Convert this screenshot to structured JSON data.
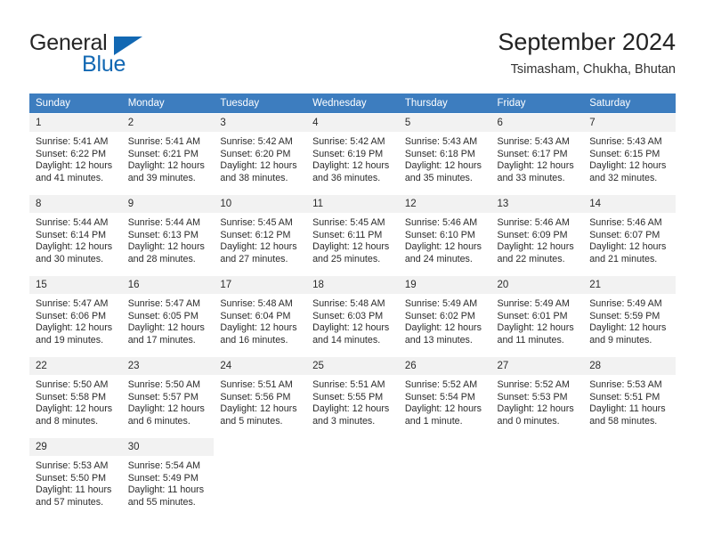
{
  "brand": {
    "name_part1": "General",
    "name_part2": "Blue",
    "triangle_color": "#1268b3",
    "text_color": "#262626"
  },
  "header": {
    "title": "September 2024",
    "subtitle": "Tsimasham, Chukha, Bhutan"
  },
  "colors": {
    "header_row": "#3d7dbf",
    "daynum_bar": "#f2f2f2",
    "separator": "#d9d9d9",
    "accent_blue": "#1268b3"
  },
  "weekdays": [
    "Sunday",
    "Monday",
    "Tuesday",
    "Wednesday",
    "Thursday",
    "Friday",
    "Saturday"
  ],
  "weeks": [
    [
      {
        "day": "1",
        "sunrise": "Sunrise: 5:41 AM",
        "sunset": "Sunset: 6:22 PM",
        "daylight1": "Daylight: 12 hours",
        "daylight2": "and 41 minutes."
      },
      {
        "day": "2",
        "sunrise": "Sunrise: 5:41 AM",
        "sunset": "Sunset: 6:21 PM",
        "daylight1": "Daylight: 12 hours",
        "daylight2": "and 39 minutes."
      },
      {
        "day": "3",
        "sunrise": "Sunrise: 5:42 AM",
        "sunset": "Sunset: 6:20 PM",
        "daylight1": "Daylight: 12 hours",
        "daylight2": "and 38 minutes."
      },
      {
        "day": "4",
        "sunrise": "Sunrise: 5:42 AM",
        "sunset": "Sunset: 6:19 PM",
        "daylight1": "Daylight: 12 hours",
        "daylight2": "and 36 minutes."
      },
      {
        "day": "5",
        "sunrise": "Sunrise: 5:43 AM",
        "sunset": "Sunset: 6:18 PM",
        "daylight1": "Daylight: 12 hours",
        "daylight2": "and 35 minutes."
      },
      {
        "day": "6",
        "sunrise": "Sunrise: 5:43 AM",
        "sunset": "Sunset: 6:17 PM",
        "daylight1": "Daylight: 12 hours",
        "daylight2": "and 33 minutes."
      },
      {
        "day": "7",
        "sunrise": "Sunrise: 5:43 AM",
        "sunset": "Sunset: 6:15 PM",
        "daylight1": "Daylight: 12 hours",
        "daylight2": "and 32 minutes."
      }
    ],
    [
      {
        "day": "8",
        "sunrise": "Sunrise: 5:44 AM",
        "sunset": "Sunset: 6:14 PM",
        "daylight1": "Daylight: 12 hours",
        "daylight2": "and 30 minutes."
      },
      {
        "day": "9",
        "sunrise": "Sunrise: 5:44 AM",
        "sunset": "Sunset: 6:13 PM",
        "daylight1": "Daylight: 12 hours",
        "daylight2": "and 28 minutes."
      },
      {
        "day": "10",
        "sunrise": "Sunrise: 5:45 AM",
        "sunset": "Sunset: 6:12 PM",
        "daylight1": "Daylight: 12 hours",
        "daylight2": "and 27 minutes."
      },
      {
        "day": "11",
        "sunrise": "Sunrise: 5:45 AM",
        "sunset": "Sunset: 6:11 PM",
        "daylight1": "Daylight: 12 hours",
        "daylight2": "and 25 minutes."
      },
      {
        "day": "12",
        "sunrise": "Sunrise: 5:46 AM",
        "sunset": "Sunset: 6:10 PM",
        "daylight1": "Daylight: 12 hours",
        "daylight2": "and 24 minutes."
      },
      {
        "day": "13",
        "sunrise": "Sunrise: 5:46 AM",
        "sunset": "Sunset: 6:09 PM",
        "daylight1": "Daylight: 12 hours",
        "daylight2": "and 22 minutes."
      },
      {
        "day": "14",
        "sunrise": "Sunrise: 5:46 AM",
        "sunset": "Sunset: 6:07 PM",
        "daylight1": "Daylight: 12 hours",
        "daylight2": "and 21 minutes."
      }
    ],
    [
      {
        "day": "15",
        "sunrise": "Sunrise: 5:47 AM",
        "sunset": "Sunset: 6:06 PM",
        "daylight1": "Daylight: 12 hours",
        "daylight2": "and 19 minutes."
      },
      {
        "day": "16",
        "sunrise": "Sunrise: 5:47 AM",
        "sunset": "Sunset: 6:05 PM",
        "daylight1": "Daylight: 12 hours",
        "daylight2": "and 17 minutes."
      },
      {
        "day": "17",
        "sunrise": "Sunrise: 5:48 AM",
        "sunset": "Sunset: 6:04 PM",
        "daylight1": "Daylight: 12 hours",
        "daylight2": "and 16 minutes."
      },
      {
        "day": "18",
        "sunrise": "Sunrise: 5:48 AM",
        "sunset": "Sunset: 6:03 PM",
        "daylight1": "Daylight: 12 hours",
        "daylight2": "and 14 minutes."
      },
      {
        "day": "19",
        "sunrise": "Sunrise: 5:49 AM",
        "sunset": "Sunset: 6:02 PM",
        "daylight1": "Daylight: 12 hours",
        "daylight2": "and 13 minutes."
      },
      {
        "day": "20",
        "sunrise": "Sunrise: 5:49 AM",
        "sunset": "Sunset: 6:01 PM",
        "daylight1": "Daylight: 12 hours",
        "daylight2": "and 11 minutes."
      },
      {
        "day": "21",
        "sunrise": "Sunrise: 5:49 AM",
        "sunset": "Sunset: 5:59 PM",
        "daylight1": "Daylight: 12 hours",
        "daylight2": "and 9 minutes."
      }
    ],
    [
      {
        "day": "22",
        "sunrise": "Sunrise: 5:50 AM",
        "sunset": "Sunset: 5:58 PM",
        "daylight1": "Daylight: 12 hours",
        "daylight2": "and 8 minutes."
      },
      {
        "day": "23",
        "sunrise": "Sunrise: 5:50 AM",
        "sunset": "Sunset: 5:57 PM",
        "daylight1": "Daylight: 12 hours",
        "daylight2": "and 6 minutes."
      },
      {
        "day": "24",
        "sunrise": "Sunrise: 5:51 AM",
        "sunset": "Sunset: 5:56 PM",
        "daylight1": "Daylight: 12 hours",
        "daylight2": "and 5 minutes."
      },
      {
        "day": "25",
        "sunrise": "Sunrise: 5:51 AM",
        "sunset": "Sunset: 5:55 PM",
        "daylight1": "Daylight: 12 hours",
        "daylight2": "and 3 minutes."
      },
      {
        "day": "26",
        "sunrise": "Sunrise: 5:52 AM",
        "sunset": "Sunset: 5:54 PM",
        "daylight1": "Daylight: 12 hours",
        "daylight2": "and 1 minute."
      },
      {
        "day": "27",
        "sunrise": "Sunrise: 5:52 AM",
        "sunset": "Sunset: 5:53 PM",
        "daylight1": "Daylight: 12 hours",
        "daylight2": "and 0 minutes."
      },
      {
        "day": "28",
        "sunrise": "Sunrise: 5:53 AM",
        "sunset": "Sunset: 5:51 PM",
        "daylight1": "Daylight: 11 hours",
        "daylight2": "and 58 minutes."
      }
    ],
    [
      {
        "day": "29",
        "sunrise": "Sunrise: 5:53 AM",
        "sunset": "Sunset: 5:50 PM",
        "daylight1": "Daylight: 11 hours",
        "daylight2": "and 57 minutes."
      },
      {
        "day": "30",
        "sunrise": "Sunrise: 5:54 AM",
        "sunset": "Sunset: 5:49 PM",
        "daylight1": "Daylight: 11 hours",
        "daylight2": "and 55 minutes."
      },
      {
        "day": "",
        "sunrise": "",
        "sunset": "",
        "daylight1": "",
        "daylight2": ""
      },
      {
        "day": "",
        "sunrise": "",
        "sunset": "",
        "daylight1": "",
        "daylight2": ""
      },
      {
        "day": "",
        "sunrise": "",
        "sunset": "",
        "daylight1": "",
        "daylight2": ""
      },
      {
        "day": "",
        "sunrise": "",
        "sunset": "",
        "daylight1": "",
        "daylight2": ""
      },
      {
        "day": "",
        "sunrise": "",
        "sunset": "",
        "daylight1": "",
        "daylight2": ""
      }
    ]
  ]
}
